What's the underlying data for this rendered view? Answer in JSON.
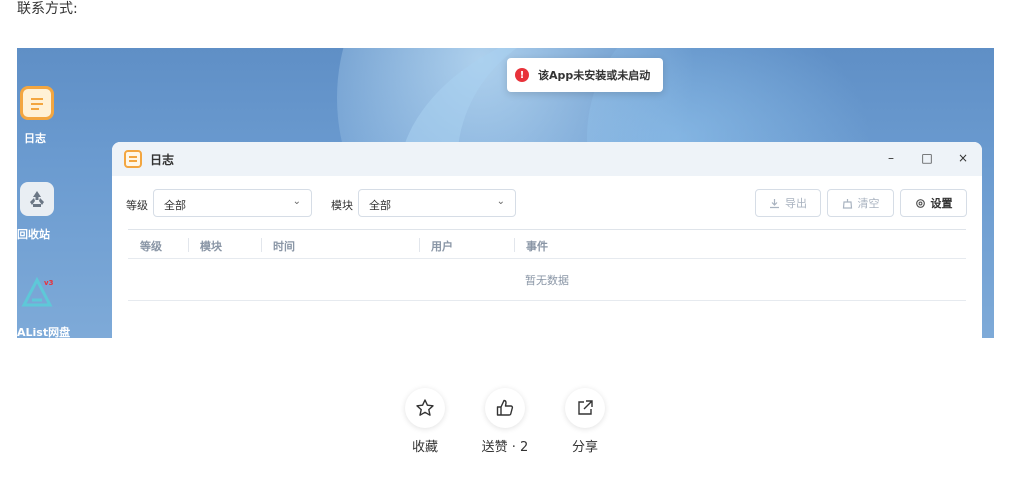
{
  "article": {
    "contact_label": "联系方式:"
  },
  "desktop": {
    "icons": [
      {
        "label": "日志"
      },
      {
        "label": "回收站"
      },
      {
        "label": "AList网盘"
      }
    ]
  },
  "toast": {
    "icon": "!",
    "message": "该App未安装或未启动"
  },
  "window": {
    "title": "日志",
    "controls": {
      "minimize": "–",
      "maximize": "□",
      "close": "×"
    },
    "filters": {
      "level_label": "等级",
      "level_value": "全部",
      "module_label": "模块",
      "module_value": "全部"
    },
    "buttons": {
      "export": "导出",
      "clear": "清空",
      "settings": "设置"
    },
    "table": {
      "columns": [
        "等级",
        "模块",
        "时间",
        "用户",
        "事件"
      ],
      "empty_text": "暂无数据"
    }
  },
  "actions": {
    "favorite": {
      "label": "收藏",
      "icon": "star-icon"
    },
    "like": {
      "label": "送赞 · 2",
      "icon": "thumbs-up-icon"
    },
    "share": {
      "label": "分享",
      "icon": "share-icon"
    }
  },
  "colors": {
    "desktop_bg": "#6b9bd0",
    "error_red": "#e8323a",
    "app_orange": "#f3a640",
    "muted_text": "#8a96a6"
  }
}
